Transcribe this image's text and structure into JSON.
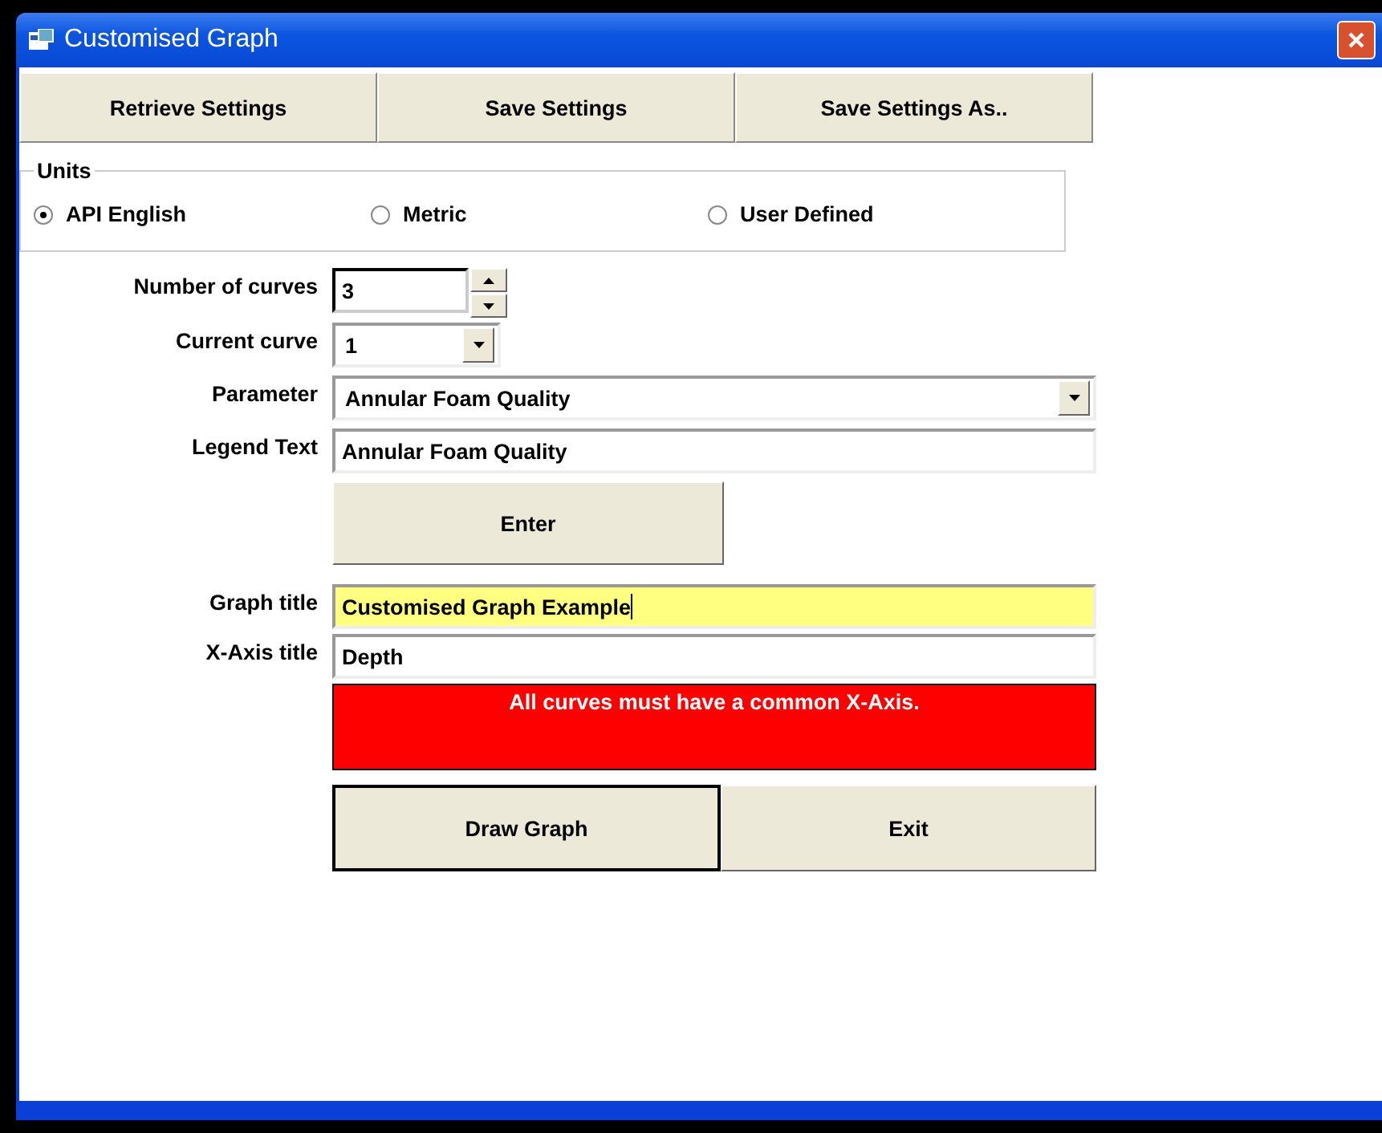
{
  "window": {
    "title": "Customised Graph"
  },
  "toolbar": [
    {
      "label": "Retrieve Settings"
    },
    {
      "label": "Save Settings"
    },
    {
      "label": "Save Settings As.."
    }
  ],
  "units": {
    "legend": "Units",
    "options": [
      {
        "label": "API English",
        "selected": true
      },
      {
        "label": "Metric",
        "selected": false
      },
      {
        "label": "User Defined",
        "selected": false
      }
    ]
  },
  "number_of_curves": {
    "label": "Number of curves",
    "value": "3"
  },
  "current_curve": {
    "label": "Current curve",
    "value": "1"
  },
  "parameter": {
    "label": "Parameter",
    "value": "Annular Foam Quality"
  },
  "legend_text": {
    "label": "Legend Text",
    "value": "Annular Foam Quality"
  },
  "enter_button": "Enter",
  "graph_title": {
    "label": "Graph title",
    "value": "Customised Graph Example",
    "focused": true
  },
  "x_axis_title": {
    "label": "X-Axis title",
    "value": "Depth"
  },
  "warning": "All curves must have a common X-Axis.",
  "bottom_buttons": [
    {
      "label": "Draw Graph",
      "default": true
    },
    {
      "label": "Exit",
      "default": false
    }
  ]
}
